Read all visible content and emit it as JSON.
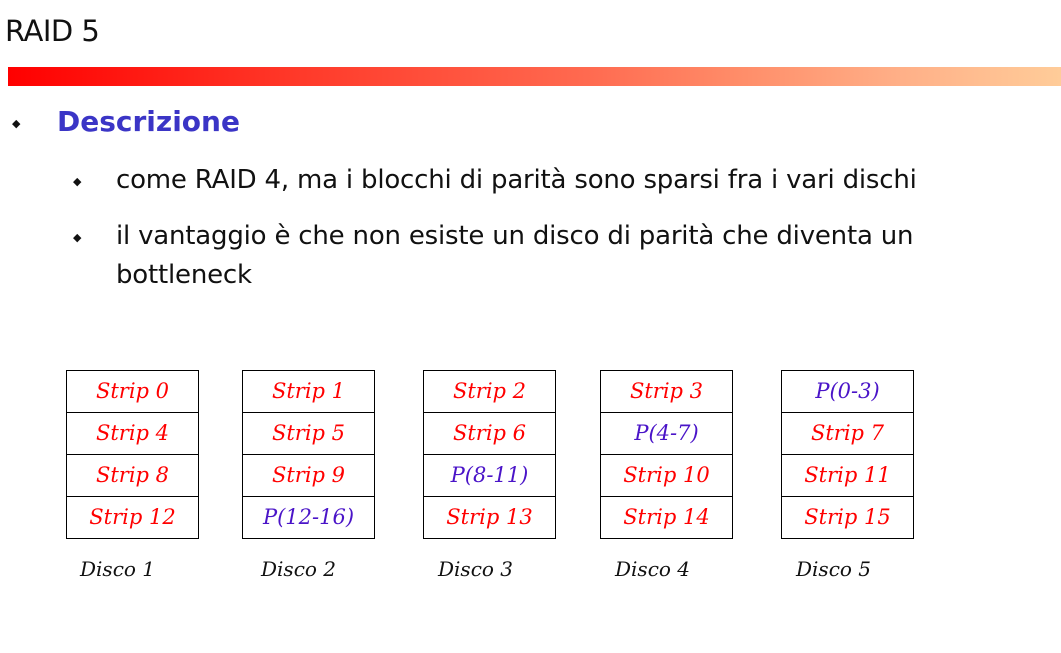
{
  "slide": {
    "title": "RAID 5",
    "accent_gradient": [
      "#ff0000",
      "#ffcc99"
    ],
    "heading": "Descrizione",
    "heading_color": "#3b35c6",
    "bullets": [
      "come RAID 4, ma i blocchi di parità sono sparsi fra i vari dischi",
      "il vantaggio è che non esiste un disco di parità che diventa un",
      "bottleneck"
    ]
  },
  "diagram": {
    "data_color": "#ff0000",
    "parity_color": "#4a14c8",
    "disks": [
      {
        "label": "Disco 1",
        "blocks": [
          "Strip 0",
          "Strip 4",
          "Strip 8",
          "Strip 12"
        ],
        "parity": [
          false,
          false,
          false,
          false
        ]
      },
      {
        "label": "Disco 2",
        "blocks": [
          "Strip 1",
          "Strip 5",
          "Strip 9",
          "P(12-16)"
        ],
        "parity": [
          false,
          false,
          false,
          true
        ]
      },
      {
        "label": "Disco 3",
        "blocks": [
          "Strip 2",
          "Strip 6",
          "P(8-11)",
          "Strip 13"
        ],
        "parity": [
          false,
          false,
          true,
          false
        ]
      },
      {
        "label": "Disco 4",
        "blocks": [
          "Strip 3",
          "P(4-7)",
          "Strip 10",
          "Strip 14"
        ],
        "parity": [
          false,
          true,
          false,
          false
        ]
      },
      {
        "label": "Disco 5",
        "blocks": [
          "P(0-3)",
          "Strip 7",
          "Strip 11",
          "Strip 15"
        ],
        "parity": [
          true,
          false,
          false,
          false
        ]
      }
    ]
  }
}
